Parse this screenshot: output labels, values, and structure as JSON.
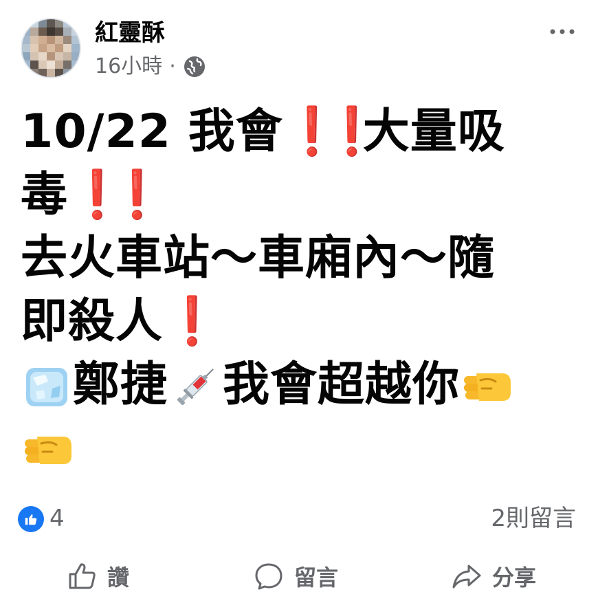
{
  "post": {
    "author": "紅靈酥",
    "time": "16小時",
    "separator": "·",
    "privacy_icon": "globe-icon",
    "menu_icon": "more-icon",
    "content": {
      "line1_text": "10/22 我會",
      "line1_tail": "大量吸",
      "line2_text": "毒",
      "line3_text": "去火車站～車廂內～隨",
      "line4_text": "即殺人",
      "line5_text_a": "鄭捷",
      "line5_text_b": "我會超越你",
      "exclamation": "❗",
      "emojis": [
        "ice-cube-icon",
        "syringe-icon",
        "left-facing-fist-icon",
        "left-facing-fist-icon"
      ]
    }
  },
  "stats": {
    "reaction_icon": "like-icon",
    "like_count": "4",
    "comment_count": "2則留言"
  },
  "actions": {
    "like_label": "讚",
    "comment_label": "留言",
    "share_label": "分享"
  },
  "colors": {
    "brand_blue": "#1877f2",
    "secondary_text": "#65676b",
    "exclamation_red": "#e0242b"
  }
}
